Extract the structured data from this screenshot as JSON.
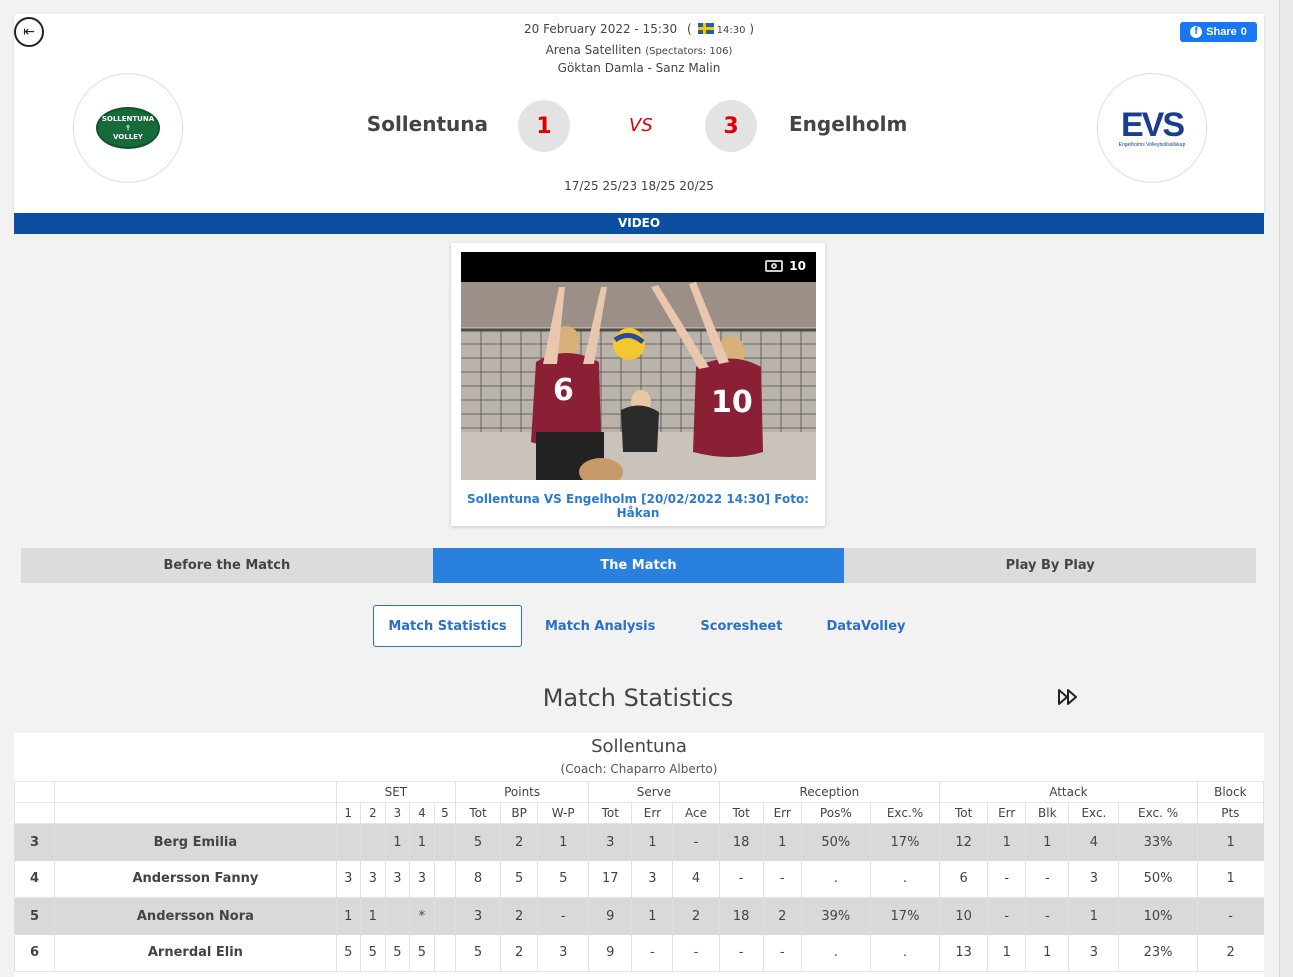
{
  "header": {
    "date": "20 February 2022 - 15:30",
    "local_time_open": "(",
    "local_time": "14:30",
    "local_time_close": ")",
    "arena": "Arena Satelliten",
    "spectators": "(Spectators: 106)",
    "referees": "Göktan Damla - Sanz Malin",
    "share_label": "Share",
    "share_count": "0",
    "home_team": "Sollentuna",
    "away_team": "Engelholm",
    "home_score": "1",
    "away_score": "3",
    "vs": "VS",
    "sets": "17/25 25/23 18/25 20/25",
    "home_logo_text": [
      "SOLLENTUNA",
      "VOLLEY"
    ],
    "away_logo_text": "EVS",
    "away_logo_sub": "Engelholms Volleybollsällskap"
  },
  "video_label": "VIDEO",
  "gallery": {
    "count": "10",
    "caption": "Sollentuna VS Engelholm [20/02/2022 14:30] Foto: Håkan"
  },
  "tabs": [
    {
      "label": "Before the Match",
      "active": false
    },
    {
      "label": "The Match",
      "active": true
    },
    {
      "label": "Play By Play",
      "active": false
    }
  ],
  "subtabs": [
    {
      "label": "Match Statistics",
      "active": true
    },
    {
      "label": "Match Analysis",
      "active": false
    },
    {
      "label": "Scoresheet",
      "active": false
    },
    {
      "label": "DataVolley",
      "active": false
    }
  ],
  "stats_title": "Match Statistics",
  "team_stats": {
    "team": "Sollentuna",
    "coach": "(Coach: Chaparro Alberto)",
    "groups": [
      "SET",
      "Points",
      "Serve",
      "Reception",
      "Attack",
      "Block"
    ],
    "subheaders": [
      "1",
      "2",
      "3",
      "4",
      "5",
      "Tot",
      "BP",
      "W-P",
      "Tot",
      "Err",
      "Ace",
      "Tot",
      "Err",
      "Pos%",
      "Exc.%",
      "Tot",
      "Err",
      "Blk",
      "Exc.",
      "Exc. %",
      "Pts"
    ],
    "rows": [
      {
        "num": "3",
        "name": "Berg Emilia",
        "cells": [
          "",
          "",
          "1",
          "1",
          "",
          "5",
          "2",
          "1",
          "3",
          "1",
          "-",
          "18",
          "1",
          "50%",
          "17%",
          "12",
          "1",
          "1",
          "4",
          "33%",
          "1"
        ]
      },
      {
        "num": "4",
        "name": "Andersson Fanny",
        "cells": [
          "3",
          "3",
          "3",
          "3",
          "",
          "8",
          "5",
          "5",
          "17",
          "3",
          "4",
          "-",
          "-",
          ".",
          ".",
          "6",
          "-",
          "-",
          "3",
          "50%",
          "1"
        ]
      },
      {
        "num": "5",
        "name": "Andersson Nora",
        "cells": [
          "1",
          "1",
          "",
          "*",
          "",
          "3",
          "2",
          "-",
          "9",
          "1",
          "2",
          "18",
          "2",
          "39%",
          "17%",
          "10",
          "-",
          "-",
          "1",
          "10%",
          "-"
        ]
      },
      {
        "num": "6",
        "name": "Arnerdal Elin",
        "cells": [
          "5",
          "5",
          "5",
          "5",
          "",
          "5",
          "2",
          "3",
          "9",
          "-",
          "-",
          "-",
          "-",
          ".",
          ".",
          "13",
          "1",
          "1",
          "3",
          "23%",
          "2"
        ]
      }
    ]
  },
  "colors": {
    "accent_blue": "#2a80dd",
    "video_bar": "#0b4fa0",
    "score_red": "#e10000",
    "row_shade": "#d9d9d9"
  }
}
